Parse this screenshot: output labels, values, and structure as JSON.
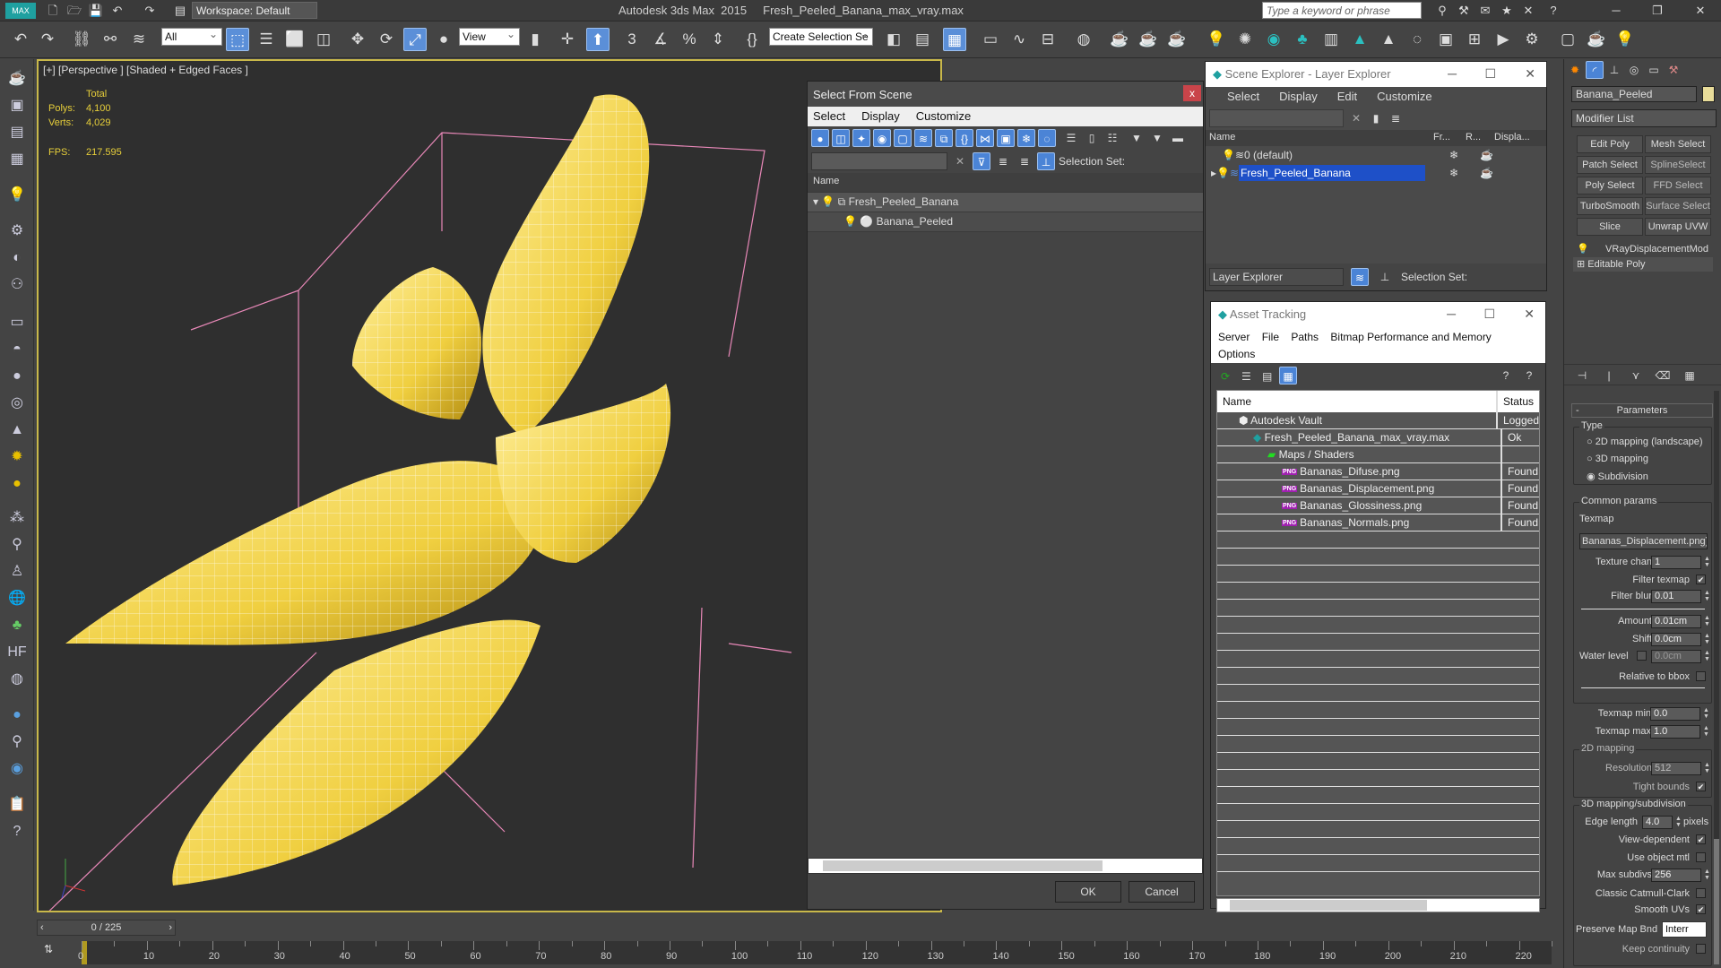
{
  "app": {
    "title": "Autodesk 3ds Max  2015",
    "file": "Fresh_Peeled_Banana_max_vray.max",
    "workspace": "Workspace: Default",
    "search_placeholder": "Type a keyword or phrase"
  },
  "toolbar": {
    "selection_filter": "All",
    "ref_coord": "View",
    "selection_set": "Create Selection Se",
    "snap_labels": [
      "3",
      "%"
    ]
  },
  "viewport": {
    "label": "[+] [Perspective ] [Shaded + Edged Faces ]",
    "stats_header": "Total",
    "polys_label": "Polys:",
    "polys": "4,100",
    "verts_label": "Verts:",
    "verts": "4,029",
    "fps_label": "FPS:",
    "fps": "217.595"
  },
  "select_from_scene": {
    "title": "Select From Scene",
    "menu": [
      "Select",
      "Display",
      "Customize"
    ],
    "selection_set_label": "Selection Set:",
    "column": "Name",
    "tree": [
      {
        "name": "Fresh_Peeled_Banana",
        "level": 0
      },
      {
        "name": "Banana_Peeled",
        "level": 1
      }
    ],
    "ok": "OK",
    "cancel": "Cancel"
  },
  "scene_explorer": {
    "title": "Scene Explorer - Layer Explorer",
    "menu": [
      "Select",
      "Display",
      "Edit",
      "Customize"
    ],
    "columns": [
      "Name",
      "Fr...",
      "R...",
      "Displa..."
    ],
    "rows": [
      {
        "name": "0 (default)",
        "selected": false
      },
      {
        "name": "Fresh_Peeled_Banana",
        "selected": true
      }
    ],
    "footer_dropdown": "Layer Explorer",
    "selection_set_label": "Selection Set:"
  },
  "asset_tracking": {
    "title": "Asset Tracking",
    "menu": [
      "Server",
      "File",
      "Paths",
      "Bitmap Performance and Memory",
      "Options"
    ],
    "columns": [
      "Name",
      "Status"
    ],
    "rows": [
      {
        "name": "Autodesk Vault",
        "status": "Logged",
        "indent": 1,
        "icon": "vault-icon"
      },
      {
        "name": "Fresh_Peeled_Banana_max_vray.max",
        "status": "Ok",
        "indent": 2,
        "icon": "max-file-icon"
      },
      {
        "name": "Maps / Shaders",
        "status": "",
        "indent": 3,
        "icon": "maps-icon"
      },
      {
        "name": "Bananas_Difuse.png",
        "status": "Found",
        "indent": 4,
        "icon": "png-icon"
      },
      {
        "name": "Bananas_Displacement.png",
        "status": "Found",
        "indent": 4,
        "icon": "png-icon"
      },
      {
        "name": "Bananas_Glossiness.png",
        "status": "Found",
        "indent": 4,
        "icon": "png-icon"
      },
      {
        "name": "Bananas_Normals.png",
        "status": "Found",
        "indent": 4,
        "icon": "png-icon"
      }
    ]
  },
  "command_panel": {
    "object_name": "Banana_Peeled",
    "object_color": "#e8dc9a",
    "modifier_list": "Modifier List",
    "modifier_buttons": [
      "Edit Poly",
      "Mesh Select",
      "Patch Select",
      "SplineSelect",
      "Poly Select",
      "FFD Select",
      "TurboSmooth",
      "Surface Select",
      "Slice",
      "Unwrap UVW"
    ],
    "stack": [
      "VRayDisplacementMod",
      "Editable Poly"
    ],
    "params": {
      "rollout": "Parameters",
      "type_label": "Type",
      "types": [
        "2D mapping (landscape)",
        "3D mapping",
        "Subdivision"
      ],
      "type_selected": "Subdivision",
      "common": "Common params",
      "texmap_label": "Texmap",
      "texmap": "Bananas_Displacement.png)",
      "texture_chan_label": "Texture chan",
      "texture_chan": "1",
      "filter_texmap_label": "Filter texmap",
      "filter_texmap": true,
      "filter_blur_label": "Filter blur",
      "filter_blur": "0.01",
      "amount_label": "Amount",
      "amount": "0.01cm",
      "shift_label": "Shift",
      "shift": "0.0cm",
      "water_label": "Water level",
      "water": "0.0cm",
      "relbbox_label": "Relative to bbox",
      "tmin_label": "Texmap min",
      "tmin": "0.0",
      "tmax_label": "Texmap max",
      "tmax": "1.0",
      "map2d": "2D mapping",
      "res_label": "Resolution",
      "res": "512",
      "tight_label": "Tight bounds",
      "map3d": "3D mapping/subdivision",
      "edge_label": "Edge length",
      "edge": "4.0",
      "pixels": "pixels",
      "viewdep_label": "View-dependent",
      "useobj_label": "Use object mtl",
      "maxsub_label": "Max subdivs",
      "maxsub": "256",
      "catmull_label": "Classic Catmull-Clark",
      "smoothuv_label": "Smooth UVs",
      "preserve_label": "Preserve Map Bnd",
      "preserve": "Interr",
      "keep_label": "Keep continuity"
    }
  },
  "timeline": {
    "frame": "0 / 225",
    "ticks": [
      "0",
      "10",
      "20",
      "30",
      "40",
      "50",
      "60",
      "70",
      "80",
      "90",
      "100",
      "110",
      "120",
      "130",
      "140",
      "150",
      "160",
      "170",
      "180",
      "190",
      "200",
      "210",
      "220"
    ]
  },
  "colors": {
    "viewport_border": "#c9b84a",
    "select_blue": "#4b84d6",
    "stat_yellow": "#e7cf3a",
    "banana": "#f0d24a"
  }
}
